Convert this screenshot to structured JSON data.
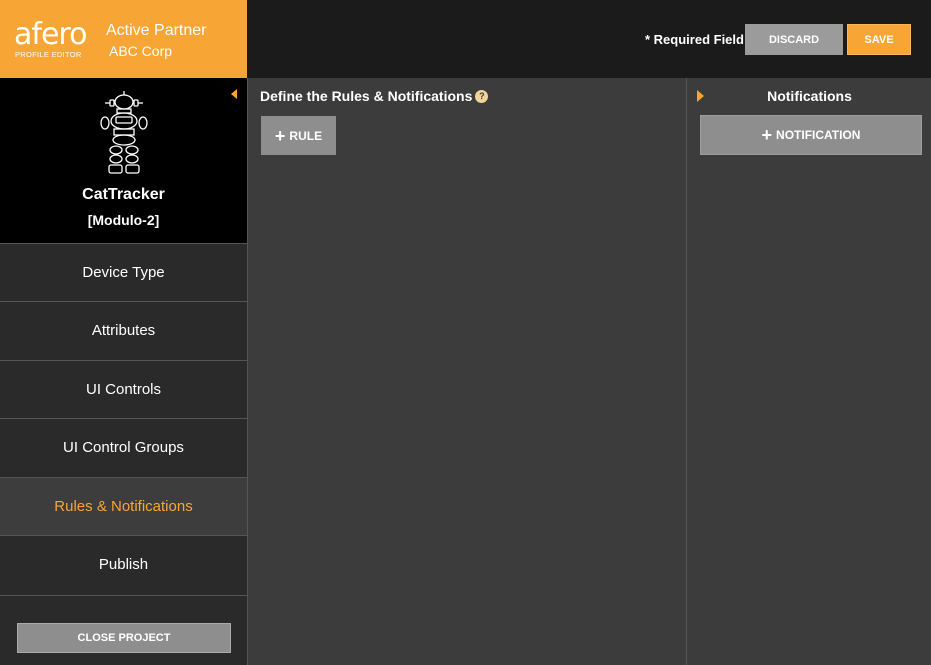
{
  "brand": {
    "logo": "afero",
    "sublogo": "PROFILE EDITOR",
    "partner_label": "Active Partner",
    "partner_name": "ABC Corp",
    "accent_color": "#f7a635"
  },
  "topbar": {
    "required_label": "* Required Field",
    "discard_label": "DISCARD",
    "save_label": "SAVE"
  },
  "device": {
    "icon": "robot-icon",
    "name": "CatTracker",
    "model": "[Modulo-2]"
  },
  "sidebar": {
    "items": [
      {
        "label": "Device Type"
      },
      {
        "label": "Attributes"
      },
      {
        "label": "UI Controls"
      },
      {
        "label": "UI Control Groups"
      },
      {
        "label": "Rules & Notifications",
        "active": true
      },
      {
        "label": "Publish"
      }
    ],
    "close_label": "CLOSE PROJECT"
  },
  "main": {
    "title": "Define the Rules & Notifications",
    "help_icon": "?",
    "add_rule_label": "RULE"
  },
  "notifications": {
    "title": "Notifications",
    "add_label": "NOTIFICATION"
  }
}
